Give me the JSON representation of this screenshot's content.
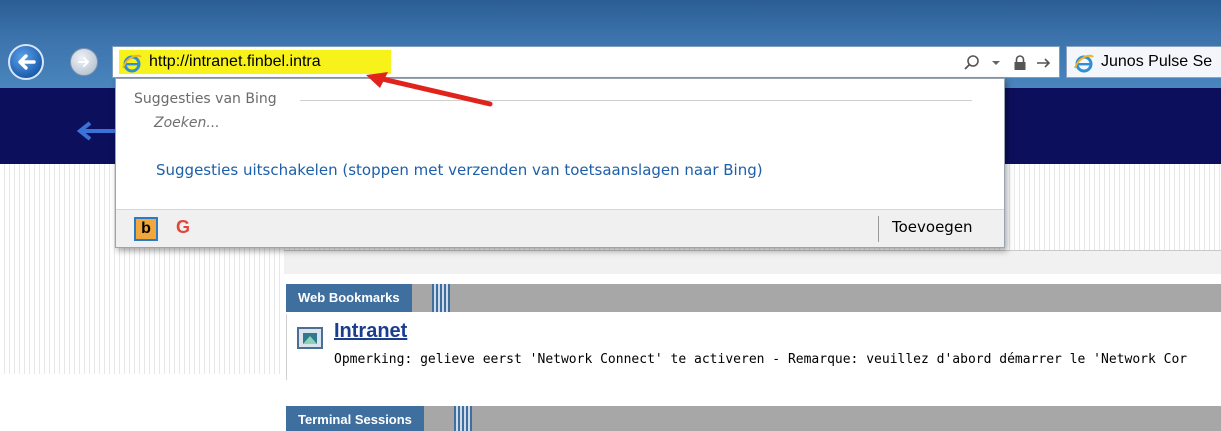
{
  "browser": {
    "url": "http://intranet.finbel.intra",
    "tab_title": "Junos Pulse Se",
    "colors": {
      "url_highlight": "#f7f31a",
      "annotation_arrow": "#e0241b"
    },
    "icons": [
      "back-arrow-icon",
      "forward-arrow-icon",
      "ie-logo-icon",
      "search-icon",
      "lock-icon",
      "refresh-arrow-icon"
    ]
  },
  "dropdown": {
    "heading": "Suggesties van Bing",
    "search_placeholder": "Zoeken...",
    "disable_link": "Suggesties uitschakelen (stoppen met verzenden van toetsaanslagen naar Bing)",
    "providers": [
      {
        "name": "Bing",
        "glyph": "b"
      },
      {
        "name": "Google",
        "glyph": "G"
      }
    ],
    "add_label": "Toevoegen"
  },
  "page": {
    "sections": [
      {
        "title": "Web Bookmarks"
      },
      {
        "title": "Terminal Sessions"
      }
    ],
    "bookmark": {
      "title": "Intranet",
      "description": "Opmerking: gelieve eerst 'Network Connect' te activeren - Remarque: veuillez d'abord démarrer le 'Network Cor"
    }
  }
}
